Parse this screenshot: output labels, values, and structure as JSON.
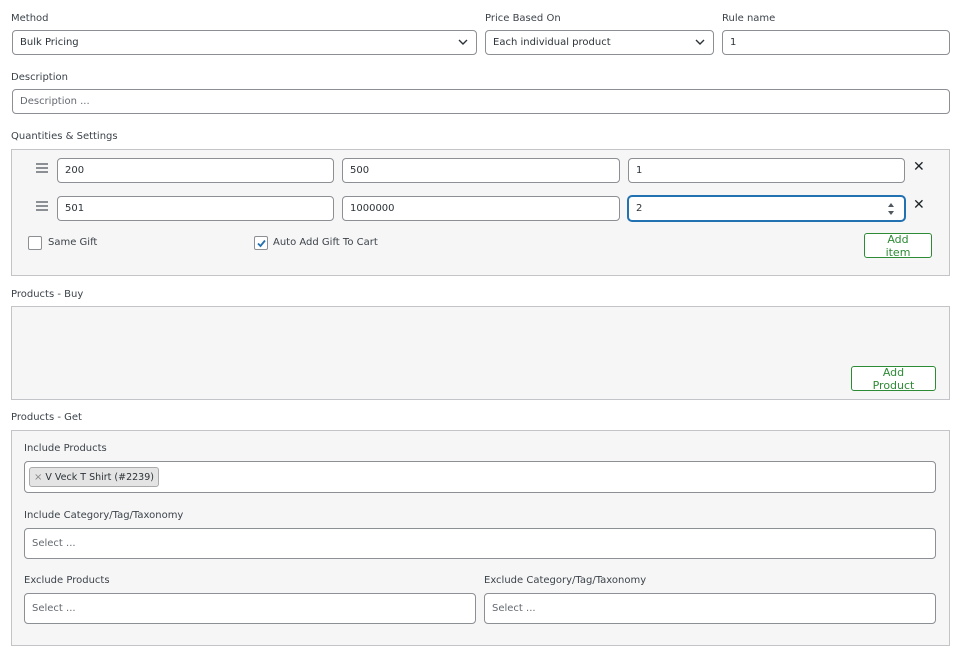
{
  "method": {
    "label": "Method",
    "value": "Bulk Pricing"
  },
  "price_based_on": {
    "label": "Price Based On",
    "value": "Each individual product"
  },
  "rule_name": {
    "label": "Rule name",
    "value": "1"
  },
  "description": {
    "label": "Description",
    "placeholder": "Description ..."
  },
  "quantities": {
    "label": "Quantities & Settings",
    "rows": [
      {
        "min": "200",
        "max": "500",
        "qty": "1",
        "remove": "✕"
      },
      {
        "min": "501",
        "max": "1000000",
        "qty": "2",
        "remove": "✕"
      }
    ],
    "same_gift": {
      "label": "Same Gift",
      "checked": false
    },
    "auto_add": {
      "label": "Auto Add Gift To Cart",
      "checked": true
    },
    "add_item": "Add item"
  },
  "products_buy": {
    "label": "Products - Buy",
    "add_product": "Add Product"
  },
  "products_get": {
    "label": "Products - Get",
    "include_products": {
      "label": "Include Products",
      "tags": [
        {
          "remove": "×",
          "text": "V Veck T Shirt (#2239)"
        }
      ]
    },
    "include_category": {
      "label": "Include Category/Tag/Taxonomy",
      "placeholder": "Select ..."
    },
    "exclude_products": {
      "label": "Exclude Products",
      "placeholder": "Select ..."
    },
    "exclude_category": {
      "label": "Exclude Category/Tag/Taxonomy",
      "placeholder": "Select ..."
    }
  },
  "colors": {
    "accent_green": "#2d8a35",
    "focus_blue": "#2271b1",
    "panel_bg": "#f6f6f6"
  }
}
